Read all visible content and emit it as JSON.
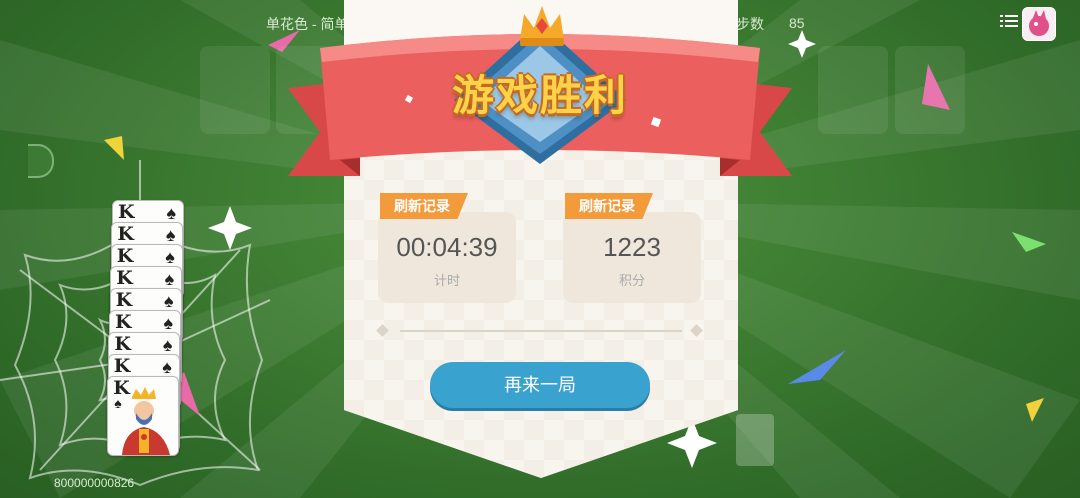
{
  "hud": {
    "mode_text": "单花色 - 简单",
    "moves_label": "步数",
    "moves_value": "85",
    "serial": "800000000826"
  },
  "side_button": "",
  "cards": {
    "rank": "K",
    "suit": "♠",
    "count": 9
  },
  "dialog": {
    "title": "游戏胜利",
    "time": {
      "badge": "刷新记录",
      "value": "00:04:39",
      "label": "计时"
    },
    "score": {
      "badge": "刷新记录",
      "value": "1223",
      "label": "积分"
    },
    "replay_button": "再来一局"
  },
  "colors": {
    "felt": "#3f7f33",
    "ribbon": "#e85a5a",
    "title_fill": "#ffd24a",
    "badge": "#f39a3b",
    "button": "#3aa2cf"
  },
  "icons": [
    "menu-icon",
    "avatar",
    "crown-icon",
    "sparkle-icon",
    "spider-web",
    "king-card"
  ]
}
